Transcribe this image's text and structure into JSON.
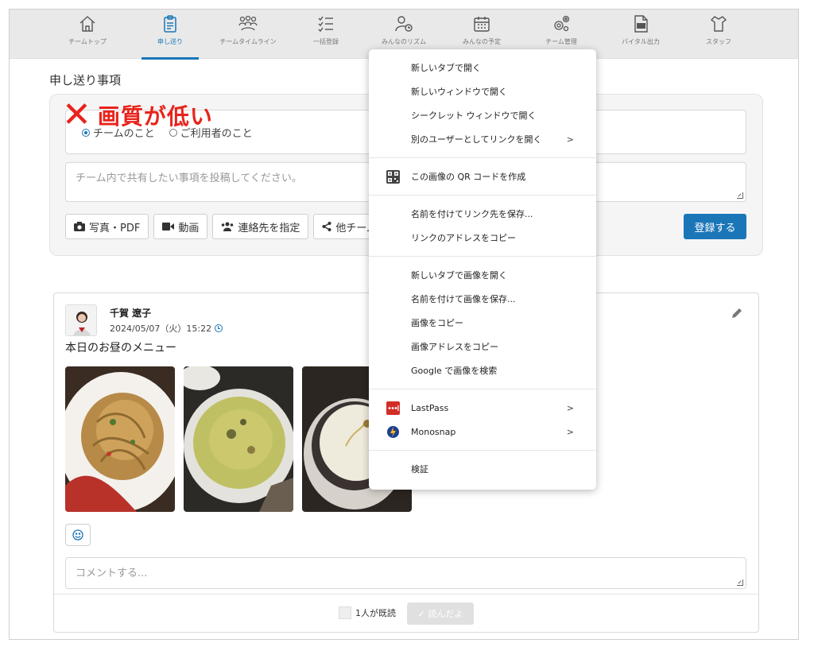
{
  "nav": {
    "items": [
      {
        "label": "チームトップ",
        "icon": "home-icon"
      },
      {
        "label": "申し送り",
        "icon": "clipboard-icon"
      },
      {
        "label": "チームタイムライン",
        "icon": "team-icon"
      },
      {
        "label": "一括登録",
        "icon": "checklist-icon"
      },
      {
        "label": "みんなのリズム",
        "icon": "user-clock-icon"
      },
      {
        "label": "みんなの予定",
        "icon": "calendar-icon"
      },
      {
        "label": "チーム管理",
        "icon": "gears-icon"
      },
      {
        "label": "バイタル出力",
        "icon": "csv-icon"
      },
      {
        "label": "スタッフ",
        "icon": "staff-icon"
      }
    ],
    "active_index": 1
  },
  "page": {
    "title": "申し送り事項"
  },
  "annotation": {
    "mark": "✕",
    "text": "画質が低い",
    "color": "#e8231b"
  },
  "compose": {
    "radio_team": "チームのこと",
    "radio_user": "ご利用者のこと",
    "placeholder": "チーム内で共有したい事項を投稿してください。",
    "buttons": {
      "photo": "写真・PDF",
      "video": "動画",
      "contacts": "連絡先を指定",
      "other_team": "他チーム"
    },
    "register": "登録する"
  },
  "post": {
    "author": "千賀 遼子",
    "date": "2024/05/07（火）15:22",
    "body": "本日のお昼のメニュー",
    "comment_placeholder": "コメントする...",
    "read_count": "1人が既読",
    "read_button": "✓ 読んだよ"
  },
  "context_menu": {
    "groups": [
      [
        "新しいタブで開く",
        "新しいウィンドウで開く",
        "シークレット ウィンドウで開く",
        "別のユーザーとしてリンクを開く"
      ],
      [
        "この画像の QR コードを作成"
      ],
      [
        "名前を付けてリンク先を保存...",
        "リンクのアドレスをコピー"
      ],
      [
        "新しいタブで画像を開く",
        "名前を付けて画像を保存...",
        "画像をコピー",
        "画像アドレスをコピー",
        "Google で画像を検索"
      ],
      [
        "LastPass",
        "Monosnap"
      ],
      [
        "検証"
      ]
    ],
    "submenu_arrow": ">"
  },
  "colors": {
    "accent": "#1b76b8",
    "nav_bg": "#e9e9e9",
    "annotation": "#e8231b"
  }
}
